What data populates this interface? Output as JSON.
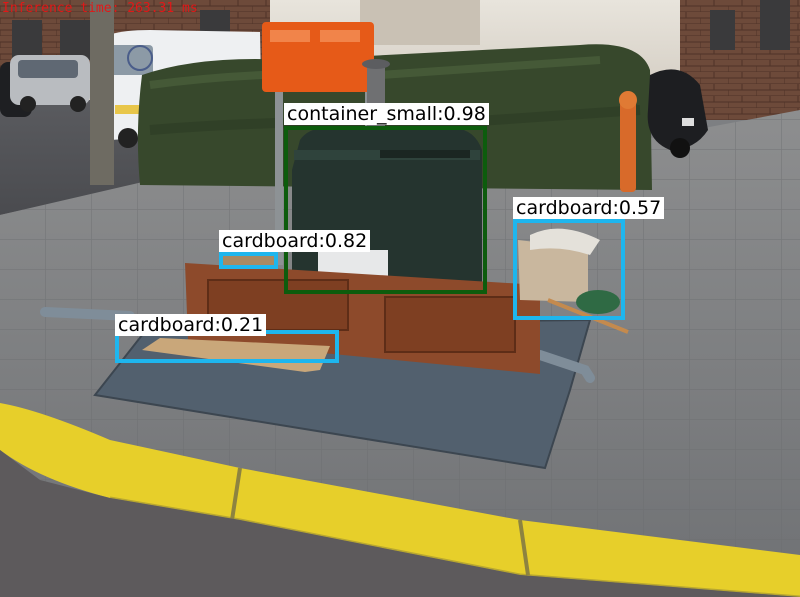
{
  "inference_text": "Inference time: 263.31 ms",
  "colors": {
    "inference_text": "#e01818",
    "container_box": "#0d5c0d",
    "cardboard_box": "#1eb6ee",
    "label_bg": "#ffffff",
    "label_text": "#000000"
  },
  "detections": [
    {
      "id": "container-small",
      "class": "container_small",
      "score": "0.98",
      "label": "container_small:0.98",
      "color": "container_box"
    },
    {
      "id": "cardboard-1",
      "class": "cardboard",
      "score": "0.57",
      "label": "cardboard:0.57",
      "color": "cardboard_box"
    },
    {
      "id": "cardboard-2",
      "class": "cardboard",
      "score": "0.82",
      "label": "cardboard:0.82",
      "color": "cardboard_box"
    },
    {
      "id": "cardboard-3",
      "class": "cardboard",
      "score": "0.21",
      "label": "cardboard:0.21",
      "color": "cardboard_box"
    }
  ]
}
